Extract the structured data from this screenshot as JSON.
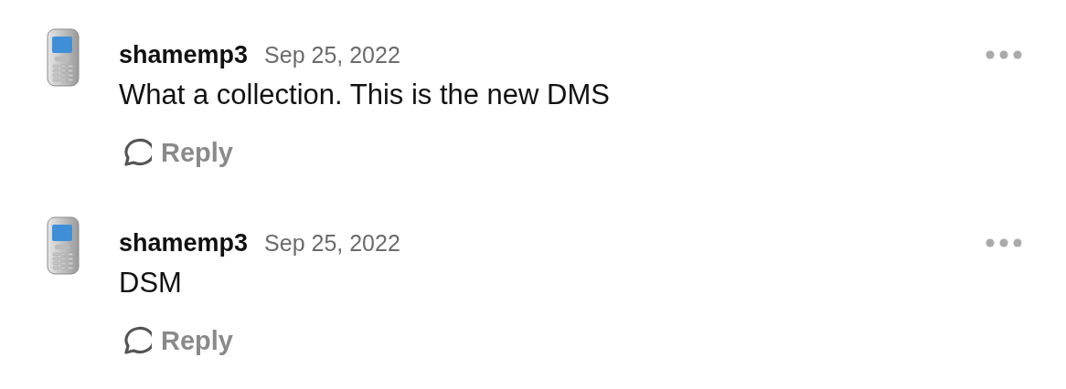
{
  "comments": [
    {
      "username": "shamemp3",
      "date": "Sep 25, 2022",
      "text": "What a collection. This is the new DMS",
      "reply": "Reply"
    },
    {
      "username": "shamemp3",
      "date": "Sep 25, 2022",
      "text": "DSM",
      "reply": "Reply"
    }
  ]
}
